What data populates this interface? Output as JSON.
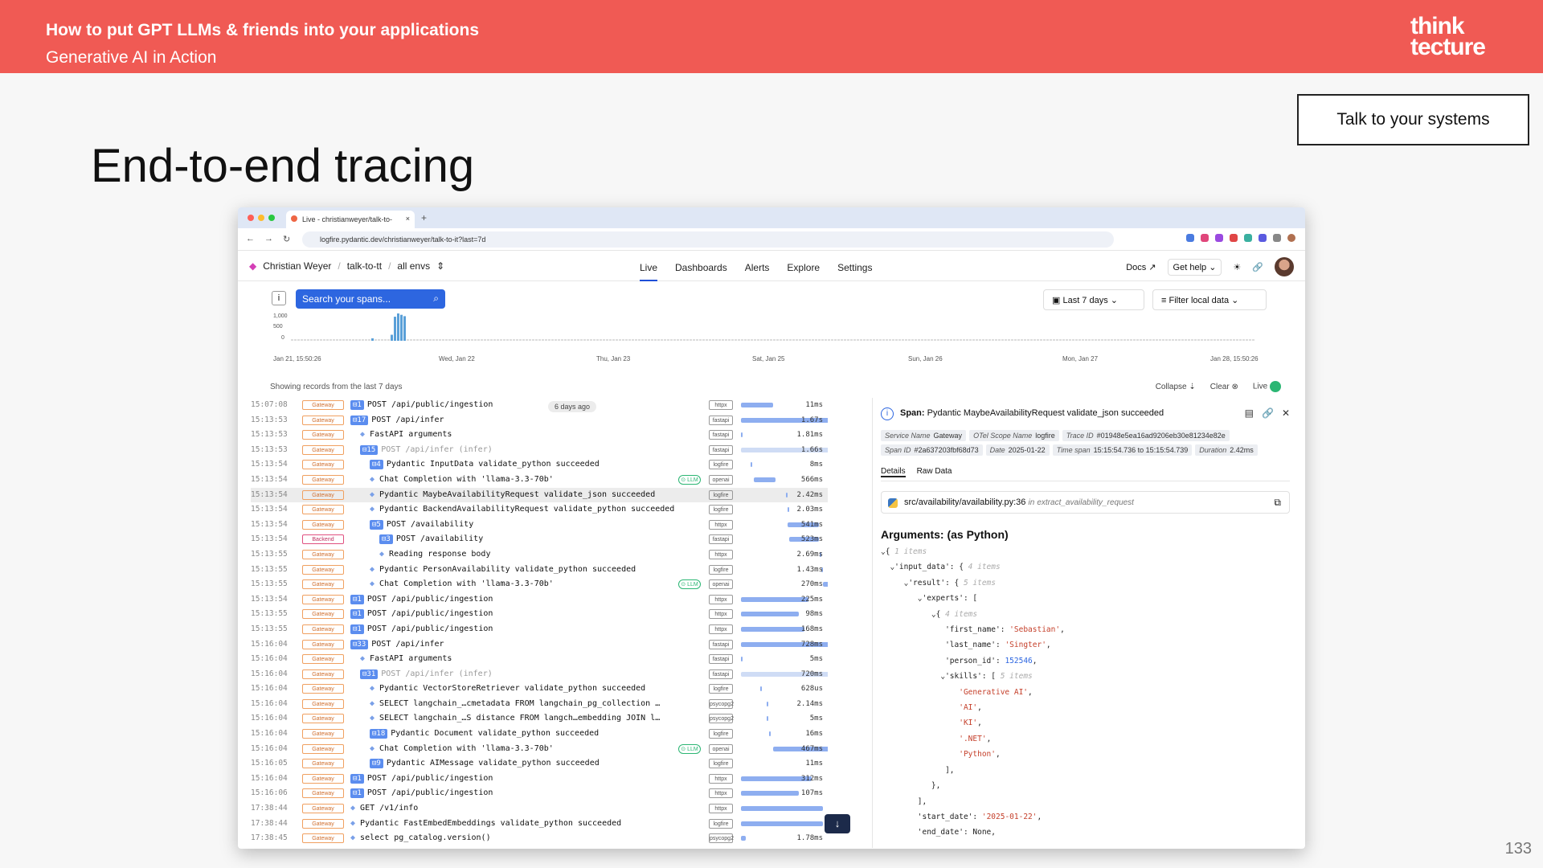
{
  "slide": {
    "header_title": "How to put GPT LLMs & friends into your applications",
    "header_subtitle": "Generative AI in Action",
    "logo_line1": "think",
    "logo_line2": "tecture",
    "badge": "Talk to your systems",
    "title": "End-to-end tracing",
    "page_number": "133"
  },
  "browser": {
    "tab_title": "Live - christianweyer/talk-to-",
    "url": "logfire.pydantic.dev/christianweyer/talk-to-it?last=7d"
  },
  "app": {
    "breadcrumb": [
      "Christian Weyer",
      "talk-to-tt",
      "all envs"
    ],
    "menu": [
      "Live",
      "Dashboards",
      "Alerts",
      "Explore",
      "Settings"
    ],
    "docs": "Docs",
    "get_help": "Get help",
    "search_placeholder": "Search your spans...",
    "time_range": "Last 7 days",
    "filter": "Filter local data",
    "hist_y": [
      "1,000",
      "500",
      "0"
    ],
    "hist_x": [
      "Jan 21, 15:50:26",
      "Wed, Jan 22",
      "Thu, Jan 23",
      "Sat, Jan 25",
      "Sun, Jan 26",
      "Mon, Jan 27",
      "Jan 28, 15:50:26"
    ],
    "hist_values": [
      0,
      0,
      0,
      0,
      0,
      0,
      0,
      0,
      0,
      0,
      0,
      0,
      0,
      0,
      0,
      0,
      0,
      0,
      0,
      0,
      0,
      0,
      0,
      0,
      0,
      0,
      0,
      0,
      0,
      0,
      0,
      0,
      0,
      0,
      0,
      0,
      0,
      0,
      0,
      0,
      0,
      0,
      0,
      0,
      0,
      0,
      0,
      0,
      0,
      0,
      0,
      0,
      0,
      0,
      0,
      0,
      0,
      0,
      0,
      0,
      0,
      0,
      0,
      0,
      0,
      0,
      0,
      0,
      0,
      0,
      0,
      0,
      0,
      0,
      0,
      0,
      0,
      0,
      0,
      0,
      0,
      0,
      0,
      0,
      0,
      0,
      0,
      0,
      0,
      0,
      0,
      0,
      0,
      0,
      0,
      0,
      0,
      0,
      0,
      0,
      0,
      0,
      0,
      0,
      0,
      0,
      0,
      0,
      0,
      0,
      0,
      0,
      0,
      0,
      0,
      0,
      0,
      0,
      0,
      0,
      0,
      0,
      0,
      0,
      0,
      0,
      0,
      0,
      0,
      0,
      0,
      0,
      0,
      0,
      0,
      0,
      0,
      0,
      0,
      0,
      0,
      0,
      0,
      0,
      0,
      0,
      0,
      0,
      0,
      0,
      0,
      0,
      0,
      0,
      0,
      0,
      0,
      0,
      0,
      0,
      0,
      0,
      0,
      0,
      0,
      0,
      0,
      0,
      0,
      0,
      0,
      0,
      0,
      0,
      0,
      0,
      0,
      0,
      0,
      0,
      0,
      0,
      0,
      0,
      0,
      0,
      0,
      0,
      0,
      0,
      0,
      0,
      0,
      0,
      0,
      0,
      0,
      0,
      0,
      0,
      0,
      0,
      0,
      0,
      0,
      0,
      0,
      0,
      0,
      0,
      0,
      0,
      0,
      0,
      0,
      0,
      0,
      0,
      0,
      0,
      0,
      0,
      0,
      0,
      0,
      0,
      0,
      0,
      0,
      0,
      0,
      0,
      0,
      0,
      0,
      0,
      0,
      0,
      0,
      0,
      0,
      0,
      0,
      0,
      0,
      0,
      0,
      0,
      0,
      0,
      0,
      0,
      0,
      0,
      0,
      0,
      0,
      0,
      0,
      0,
      0,
      0,
      0,
      0,
      0,
      0,
      0,
      0,
      0,
      0,
      0,
      0,
      0,
      0,
      0,
      0
    ],
    "showing": "Showing records from the last 7 days",
    "collapse": "Collapse",
    "clear": "Clear",
    "live": "Live",
    "ago_badge": "6 days ago"
  },
  "spans": [
    {
      "time": "15:07:08",
      "svc": "Gateway",
      "indent": 0,
      "count": "1",
      "name": "POST /api/public/ingestion",
      "lib": "httpx",
      "bar": [
        0,
        0.33
      ],
      "dur": "11ms"
    },
    {
      "time": "15:13:53",
      "svc": "Gateway",
      "indent": 0,
      "count": "17",
      "name": "POST /api/infer",
      "lib": "fastapi",
      "bar": [
        0,
        0.99
      ],
      "dur": "1.67s"
    },
    {
      "time": "15:13:53",
      "svc": "Gateway",
      "indent": 1,
      "count": "",
      "name": "FastAPI arguments",
      "lib": "fastapi",
      "bar": [
        0,
        0
      ],
      "dur": "1.81ms"
    },
    {
      "time": "15:13:53",
      "svc": "Gateway",
      "indent": 1,
      "count": "15",
      "name": "POST /api/infer (infer)",
      "lib": "fastapi",
      "bar": [
        0,
        0.99
      ],
      "dur": "1.66s",
      "muted": true
    },
    {
      "time": "15:13:54",
      "svc": "Gateway",
      "indent": 2,
      "count": "4",
      "name": "Pydantic InputData validate_python succeeded",
      "lib": "logfire",
      "bar": [
        0.1,
        0.11
      ],
      "dur": "8ms"
    },
    {
      "time": "15:13:54",
      "svc": "Gateway",
      "indent": 2,
      "count": "",
      "name": "Chat Completion with 'llama-3.3-70b'",
      "lib": "openai",
      "llm": true,
      "bar": [
        0.13,
        0.36
      ],
      "dur": "566ms"
    },
    {
      "time": "15:13:54",
      "svc": "Gateway",
      "indent": 2,
      "count": "",
      "name": "Pydantic MaybeAvailabilityRequest validate_json succeeded",
      "lib": "logfire",
      "bar": [
        0.47,
        0.48
      ],
      "dur": "2.42ms",
      "sel": true
    },
    {
      "time": "15:13:54",
      "svc": "Gateway",
      "indent": 2,
      "count": "",
      "name": "Pydantic BackendAvailabilityRequest validate_python succeeded",
      "lib": "logfire",
      "bar": [
        0.48,
        0.49
      ],
      "dur": "2.03ms"
    },
    {
      "time": "15:13:54",
      "svc": "Gateway",
      "indent": 2,
      "count": "5",
      "name": "POST /availability",
      "lib": "httpx",
      "bar": [
        0.48,
        0.81
      ],
      "dur": "541ms"
    },
    {
      "time": "15:13:54",
      "svc": "Backend",
      "indent": 3,
      "count": "3",
      "name": "POST /availability",
      "lib": "fastapi",
      "bar": [
        0.5,
        0.81
      ],
      "dur": "523ms"
    },
    {
      "time": "15:13:55",
      "svc": "Gateway",
      "indent": 3,
      "count": "",
      "name": "Reading response body",
      "lib": "httpx",
      "bar": [
        0.82,
        0.83
      ],
      "dur": "2.69ms"
    },
    {
      "time": "15:13:55",
      "svc": "Gateway",
      "indent": 2,
      "count": "",
      "name": "Pydantic PersonAvailability validate_python succeeded",
      "lib": "logfire",
      "bar": [
        0.83,
        0.84
      ],
      "dur": "1.43ms"
    },
    {
      "time": "15:13:55",
      "svc": "Gateway",
      "indent": 2,
      "count": "",
      "name": "Chat Completion with 'llama-3.3-70b'",
      "lib": "openai",
      "llm": true,
      "bar": [
        0.85,
        0.99
      ],
      "dur": "270ms"
    },
    {
      "time": "15:13:54",
      "svc": "Gateway",
      "indent": 0,
      "count": "1",
      "name": "POST /api/public/ingestion",
      "lib": "httpx",
      "bar": [
        0,
        0.7
      ],
      "dur": "225ms"
    },
    {
      "time": "15:13:55",
      "svc": "Gateway",
      "indent": 0,
      "count": "1",
      "name": "POST /api/public/ingestion",
      "lib": "httpx",
      "bar": [
        0,
        0.6
      ],
      "dur": "98ms"
    },
    {
      "time": "15:13:55",
      "svc": "Gateway",
      "indent": 0,
      "count": "1",
      "name": "POST /api/public/ingestion",
      "lib": "httpx",
      "bar": [
        0,
        0.66
      ],
      "dur": "168ms"
    },
    {
      "time": "15:16:04",
      "svc": "Gateway",
      "indent": 0,
      "count": "33",
      "name": "POST /api/infer",
      "lib": "fastapi",
      "bar": [
        0,
        0.99
      ],
      "dur": "728ms"
    },
    {
      "time": "15:16:04",
      "svc": "Gateway",
      "indent": 1,
      "count": "",
      "name": "FastAPI arguments",
      "lib": "fastapi",
      "bar": [
        0,
        0
      ],
      "dur": "5ms"
    },
    {
      "time": "15:16:04",
      "svc": "Gateway",
      "indent": 1,
      "count": "31",
      "name": "POST /api/infer (infer)",
      "lib": "fastapi",
      "bar": [
        0,
        0.99
      ],
      "dur": "720ms",
      "muted": true
    },
    {
      "time": "15:16:04",
      "svc": "Gateway",
      "indent": 2,
      "count": "",
      "name": "Pydantic VectorStoreRetriever validate_python succeeded",
      "lib": "logfire",
      "bar": [
        0.2,
        0.21
      ],
      "dur": "628us"
    },
    {
      "time": "15:16:04",
      "svc": "Gateway",
      "indent": 2,
      "count": "",
      "name": "SELECT langchain_…cmetadata FROM langchain_pg_collection …",
      "lib": "psycopg2",
      "bar": [
        0.27,
        0.28
      ],
      "dur": "2.14ms"
    },
    {
      "time": "15:16:04",
      "svc": "Gateway",
      "indent": 2,
      "count": "",
      "name": "SELECT langchain_…S distance FROM langch…embedding JOIN l…",
      "lib": "psycopg2",
      "bar": [
        0.27,
        0.28
      ],
      "dur": "5ms"
    },
    {
      "time": "15:16:04",
      "svc": "Gateway",
      "indent": 2,
      "count": "18",
      "name": "Pydantic Document validate_python succeeded",
      "lib": "logfire",
      "bar": [
        0.29,
        0.3
      ],
      "dur": "16ms"
    },
    {
      "time": "15:16:04",
      "svc": "Gateway",
      "indent": 2,
      "count": "",
      "name": "Chat Completion with 'llama-3.3-70b'",
      "lib": "openai",
      "llm": true,
      "bar": [
        0.33,
        0.97
      ],
      "dur": "467ms"
    },
    {
      "time": "15:16:05",
      "svc": "Gateway",
      "indent": 2,
      "count": "9",
      "name": "Pydantic AIMessage validate_python succeeded",
      "lib": "logfire",
      "bar": [
        0.98,
        0.99
      ],
      "dur": "11ms"
    },
    {
      "time": "15:16:04",
      "svc": "Gateway",
      "indent": 0,
      "count": "1",
      "name": "POST /api/public/ingestion",
      "lib": "httpx",
      "bar": [
        0,
        0.73
      ],
      "dur": "312ms"
    },
    {
      "time": "15:16:06",
      "svc": "Gateway",
      "indent": 0,
      "count": "1",
      "name": "POST /api/public/ingestion",
      "lib": "httpx",
      "bar": [
        0,
        0.6
      ],
      "dur": "107ms"
    },
    {
      "time": "17:38:44",
      "svc": "Gateway",
      "indent": 0,
      "count": "",
      "name": "GET /v1/info",
      "lib": "httpx",
      "bar": [
        0,
        0.85
      ],
      "dur": ""
    },
    {
      "time": "17:38:44",
      "svc": "Gateway",
      "indent": 0,
      "count": "",
      "name": "Pydantic FastEmbedEmbeddings validate_python succeeded",
      "lib": "logfire",
      "bar": [
        0,
        0.85
      ],
      "dur": ""
    },
    {
      "time": "17:38:45",
      "svc": "Gateway",
      "indent": 0,
      "count": "",
      "name": "select pg_catalog.version()",
      "lib": "psycopg2",
      "bar": [
        0,
        0.05
      ],
      "dur": "1.78ms"
    }
  ],
  "detail": {
    "span_label": "Span:",
    "span_name": "Pydantic MaybeAvailabilityRequest validate_json succeeded",
    "tags": [
      {
        "k": "Service Name",
        "v": "Gateway"
      },
      {
        "k": "OTel Scope Name",
        "v": "logfire"
      },
      {
        "k": "Trace ID",
        "v": "#01948e5ea16ad9206eb30e81234e82e"
      },
      {
        "k": "Span ID",
        "v": "#2a637203fbf68d73"
      },
      {
        "k": "Date",
        "v": "2025-01-22"
      },
      {
        "k": "Time span",
        "v": "15:15:54.736 to 15:15:54.739"
      },
      {
        "k": "Duration",
        "v": "2.42ms"
      }
    ],
    "tabs": [
      "Details",
      "Raw Data"
    ],
    "source": "src/availability/availability.py:36",
    "source_in": "in",
    "source_func": "extract_availability_request",
    "args_heading": "Arguments: (as Python)",
    "code_lines": [
      "⌄{ 1 items",
      "  ⌄'input_data': { 4 items",
      "     ⌄'result': { 5 items",
      "        ⌄'experts': [",
      "           ⌄{ 4 items",
      "              'first_name': 'Sebastian',",
      "              'last_name': 'Singter',",
      "              'person_id': 152546,",
      "             ⌄'skills': [ 5 items",
      "                 'Generative AI',",
      "                 'AI',",
      "                 'KI',",
      "                 '.NET',",
      "                 'Python',",
      "              ],",
      "           },",
      "        ],",
      "        'start_date': '2025-01-22',",
      "        'end_date': None,"
    ]
  },
  "colors": {
    "accent": "#f05a54",
    "primary": "#2d66e0",
    "live": "#2bb673"
  }
}
